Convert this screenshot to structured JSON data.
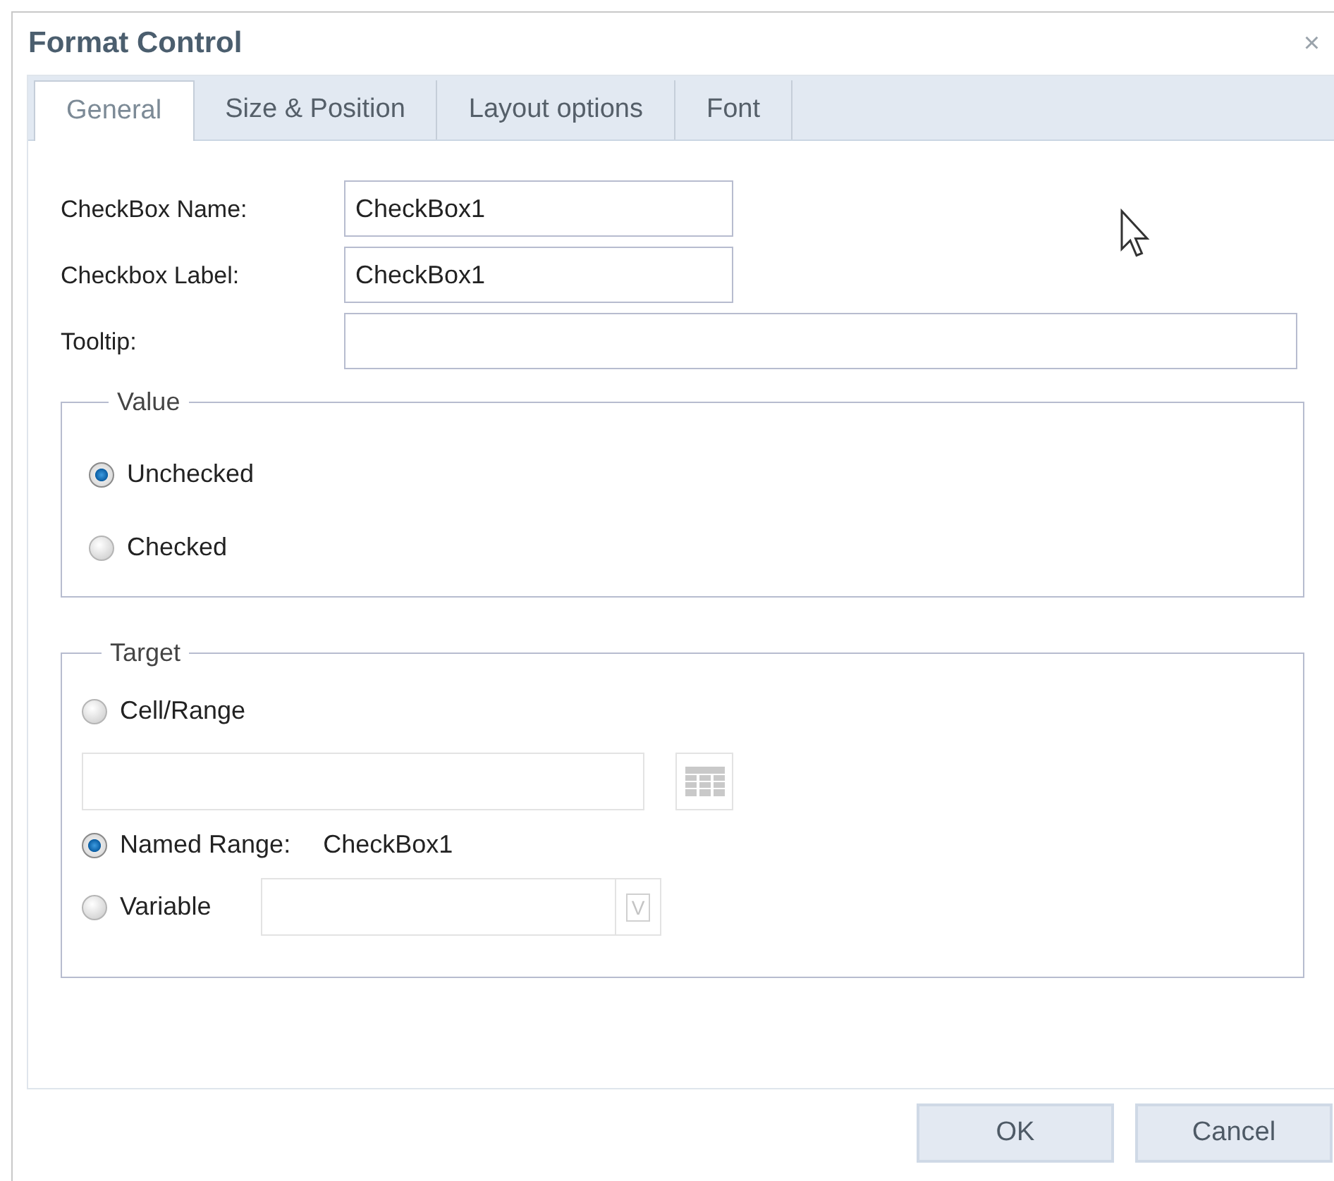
{
  "window": {
    "title": "Format Control",
    "close": "×"
  },
  "tabs": [
    {
      "label": "General",
      "selected": true
    },
    {
      "label": "Size & Position",
      "selected": false
    },
    {
      "label": "Layout options",
      "selected": false
    },
    {
      "label": "Font",
      "selected": false
    }
  ],
  "fields": [
    {
      "label": "CheckBox Name:",
      "value": "CheckBox1",
      "kind": "short"
    },
    {
      "label": "Checkbox Label:",
      "value": "CheckBox1",
      "kind": "short"
    },
    {
      "label": "Tooltip:",
      "kind": "long"
    }
  ],
  "value_group": {
    "title": "Value",
    "options": [
      {
        "label": "Unchecked",
        "selected": true
      },
      {
        "label": "Checked",
        "selected": false
      }
    ]
  },
  "target_group": {
    "title": "Target",
    "cell_range": {
      "label": "Cell/Range",
      "selected": false
    },
    "named_range": {
      "label": "Named Range:",
      "selected": true,
      "value": "CheckBox1"
    },
    "variable": {
      "label": "Variable",
      "selected": false,
      "button": "V"
    }
  },
  "buttons": [
    "OK",
    "Cancel"
  ]
}
